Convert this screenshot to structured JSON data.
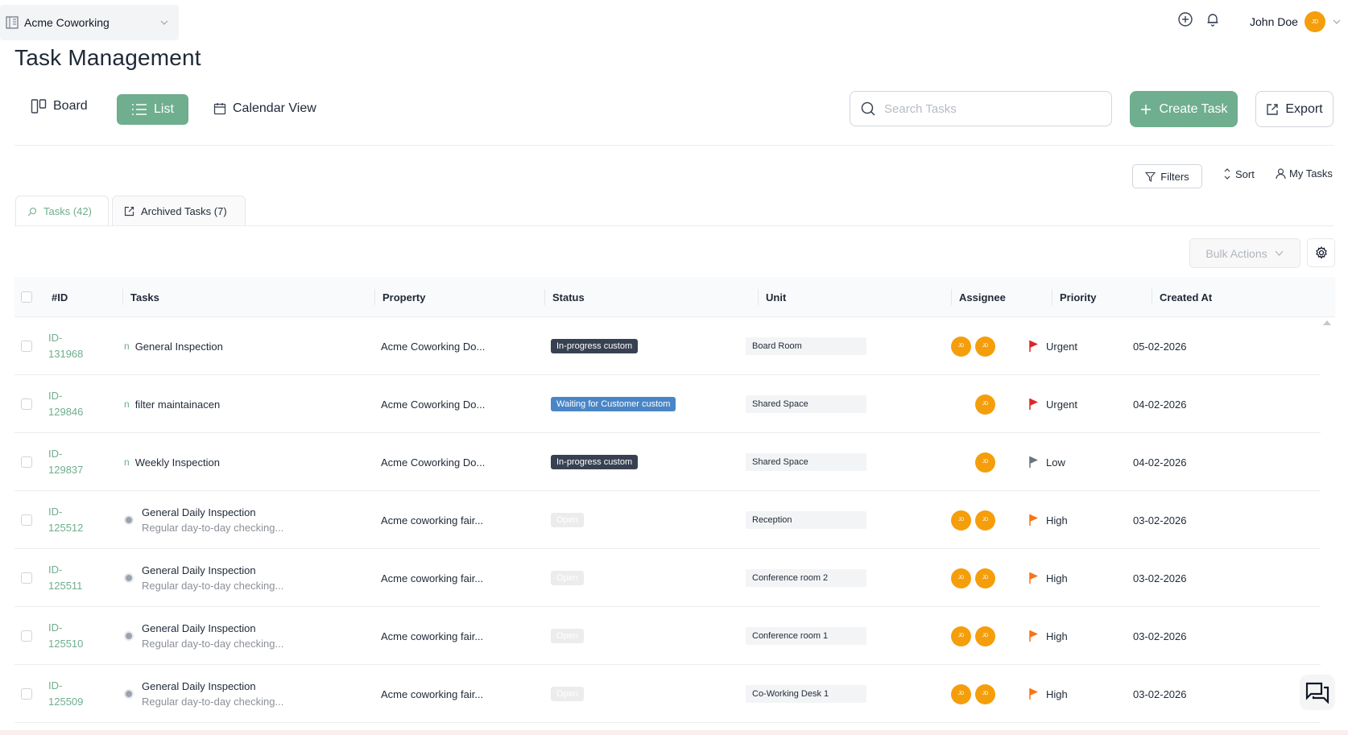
{
  "org": {
    "name": "Acme Coworking"
  },
  "user": {
    "name": "John Doe",
    "initials": "JD"
  },
  "page_title": "Task Management",
  "views": {
    "board": "Board",
    "list": "List",
    "calendar": "Calendar View"
  },
  "search": {
    "placeholder": "Search Tasks"
  },
  "actions": {
    "create": "Create Task",
    "export": "Export"
  },
  "toolbar": {
    "filters": "Filters",
    "sort": "Sort",
    "my_tasks": "My Tasks"
  },
  "tabs": {
    "tasks": "Tasks (42)",
    "archived": "Archived Tasks (7)"
  },
  "bulk_actions": "Bulk Actions",
  "columns": {
    "id": "#ID",
    "tasks": "Tasks",
    "property": "Property",
    "status": "Status",
    "unit": "Unit",
    "assignee": "Assignee",
    "priority": "Priority",
    "created_at": "Created At"
  },
  "colors": {
    "accent": "#6fae8e",
    "avatar": "#f59e0b",
    "badge_dark": "#374151",
    "badge_blue": "#4a86c5",
    "flag_urgent": "#dc2626",
    "flag_low": "#6b7280",
    "flag_high": "#f97316"
  },
  "rows": [
    {
      "id_prefix": "ID-",
      "id_num": "131968",
      "marker": "n",
      "title": "General Inspection",
      "subtitle": "",
      "property": "Acme Coworking Do...",
      "status": "In-progress custom",
      "status_style": "dark",
      "unit": "Board Room",
      "assignees": 2,
      "priority": "Urgent",
      "created": "05-02-2026"
    },
    {
      "id_prefix": "ID-",
      "id_num": "129846",
      "marker": "n",
      "title": "filter maintainacen",
      "subtitle": "",
      "property": "Acme Coworking Do...",
      "status": "Waiting for Customer custom",
      "status_style": "blue",
      "unit": "Shared Space",
      "assignees": 1,
      "priority": "Urgent",
      "created": "04-02-2026"
    },
    {
      "id_prefix": "ID-",
      "id_num": "129837",
      "marker": "n",
      "title": "Weekly Inspection",
      "subtitle": "",
      "property": "Acme Coworking Do...",
      "status": "In-progress custom",
      "status_style": "dark",
      "unit": "Shared Space",
      "assignees": 1,
      "priority": "Low",
      "created": "04-02-2026"
    },
    {
      "id_prefix": "ID-",
      "id_num": "125512",
      "marker": "dot",
      "title": "General Daily Inspection",
      "subtitle": "Regular day-to-day checking...",
      "property": "Acme coworking fair...",
      "status": "Open",
      "status_style": "open",
      "unit": "Reception",
      "assignees": 2,
      "priority": "High",
      "created": "03-02-2026"
    },
    {
      "id_prefix": "ID-",
      "id_num": "125511",
      "marker": "dot",
      "title": "General Daily Inspection",
      "subtitle": "Regular day-to-day checking...",
      "property": "Acme coworking fair...",
      "status": "Open",
      "status_style": "open",
      "unit": "Conference room 2",
      "assignees": 2,
      "priority": "High",
      "created": "03-02-2026"
    },
    {
      "id_prefix": "ID-",
      "id_num": "125510",
      "marker": "dot",
      "title": "General Daily Inspection",
      "subtitle": "Regular day-to-day checking...",
      "property": "Acme coworking fair...",
      "status": "Open",
      "status_style": "open",
      "unit": "Conference room 1",
      "assignees": 2,
      "priority": "High",
      "created": "03-02-2026"
    },
    {
      "id_prefix": "ID-",
      "id_num": "125509",
      "marker": "dot",
      "title": "General Daily Inspection",
      "subtitle": "Regular day-to-day checking...",
      "property": "Acme coworking fair...",
      "status": "Open",
      "status_style": "open",
      "unit": "Co-Working Desk 1",
      "assignees": 2,
      "priority": "High",
      "created": "03-02-2026"
    }
  ]
}
